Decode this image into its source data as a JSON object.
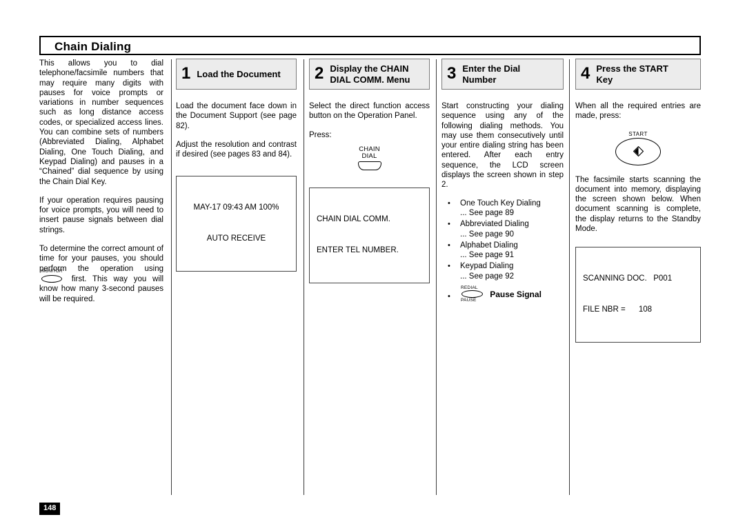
{
  "page": {
    "title": "Chain Dialing",
    "number": "148"
  },
  "intro": {
    "paragraphs": [
      "This allows you to dial telephone/facsimile numbers that may require many digits with pauses for voice prompts or variations in number sequences such as long distance access codes, or specialized access lines. You can combine sets of numbers (Abbreviated Dialing, Alphabet Dialing, One Touch Dialing, and Keypad Dialing) and pauses in a “Chained” dial sequence by using the Chain Dial Key.",
      "If your operation requires pausing for voice prompts, you will need to insert pause signals between dial strings."
    ],
    "monitor_paragraph": {
      "before": "To determine the correct amount of time for your pauses, you should perform the operation using",
      "key_label": "MONITOR",
      "after": "first. This way you will know how many 3-second pauses will be required."
    }
  },
  "steps": [
    {
      "number": "1",
      "label": "Load the Document",
      "paragraphs": [
        "Load the document face down in the Document Support (see page 82).",
        "Adjust the resolution and contrast if desired (see pages 83 and 84)."
      ],
      "lcd": {
        "line1": "MAY-17 09:43 AM 100%",
        "line2": "AUTO RECEIVE"
      }
    },
    {
      "number": "2",
      "label": "Display the CHAIN DIAL COMM. Menu",
      "paragraphs": [
        "Select the direct function access button on the Operation Panel.",
        "Press:"
      ],
      "button": {
        "line1": "CHAIN",
        "line2": "DIAL"
      },
      "lcd": {
        "line1": "CHAIN DIAL COMM.",
        "line2": "ENTER TEL NUMBER."
      }
    },
    {
      "number": "3",
      "label": "Enter the Dial Number",
      "paragraphs": [
        "Start constructing your dialing sequence using any of the following dialing methods. You may use them consecutively until your entire dialing string has been entered. After each entry sequence, the LCD screen displays the screen shown in step 2."
      ],
      "dial_methods": [
        {
          "name": "One Touch Key Dialing",
          "reference": "... See page 89"
        },
        {
          "name": "Abbreviated Dialing",
          "reference": "... See page 90"
        },
        {
          "name": "Alphabet Dialing",
          "reference": "... See page 91"
        },
        {
          "name": "Keypad Dialing",
          "reference": "... See page 92"
        }
      ],
      "pause_item": {
        "key_top": "REDIAL",
        "key_bottom": "PAUSE",
        "text": "Pause Signal"
      }
    },
    {
      "number": "4",
      "label": "Press the START Key",
      "paragraphs": [
        "When all the required entries are made, press:"
      ],
      "start_key": {
        "label": "START"
      },
      "paragraphs_after": [
        "The facsimile starts scanning the document into memory, displaying the screen shown below. When document scanning is complete, the display returns to the Standby Mode."
      ],
      "lcd": {
        "line1": "SCANNING DOC.   P001",
        "line2": "FILE NBR =      108"
      }
    }
  ]
}
